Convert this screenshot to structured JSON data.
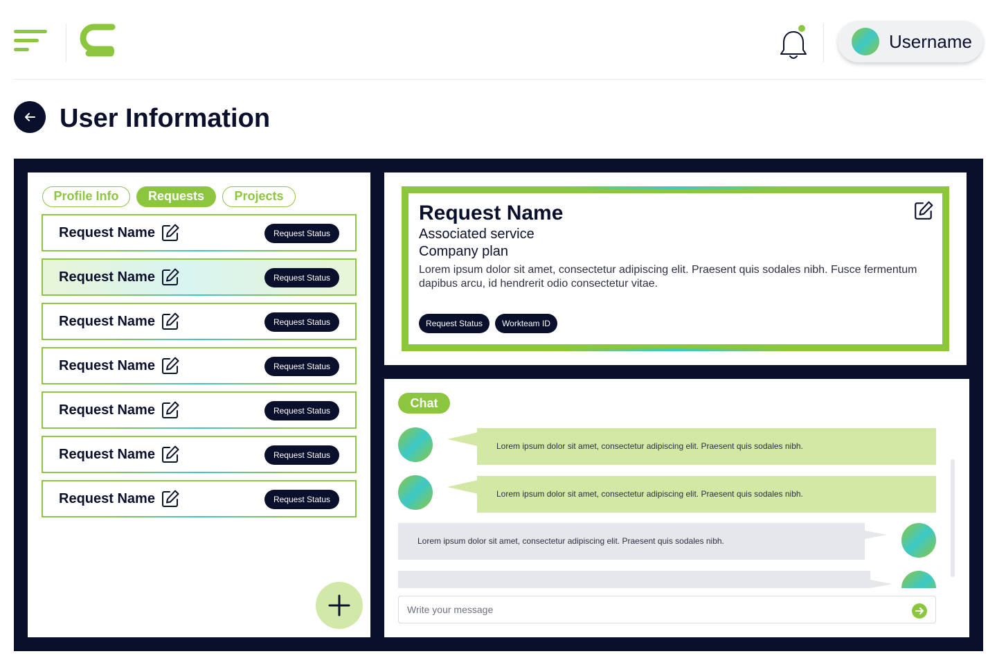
{
  "header": {
    "user_name": "Username",
    "notification_dot_color": "#8cc63f"
  },
  "page": {
    "title": "User Information"
  },
  "tabs": [
    {
      "label": "Profile Info",
      "active": false
    },
    {
      "label": "Requests",
      "active": true
    },
    {
      "label": "Projects",
      "active": false
    }
  ],
  "requests": [
    {
      "name": "Request Name",
      "status": "Request Status",
      "selected": false
    },
    {
      "name": "Request Name",
      "status": "Request Status",
      "selected": true
    },
    {
      "name": "Request Name",
      "status": "Request Status",
      "selected": false
    },
    {
      "name": "Request Name",
      "status": "Request Status",
      "selected": false
    },
    {
      "name": "Request Name",
      "status": "Request Status",
      "selected": false
    },
    {
      "name": "Request Name",
      "status": "Request Status",
      "selected": false
    },
    {
      "name": "Request Name",
      "status": "Request Status",
      "selected": false
    }
  ],
  "detail": {
    "title": "Request Name",
    "service": "Associated service",
    "plan": "Company plan",
    "description": "Lorem ipsum dolor sit amet, consectetur adipiscing elit. Praesent quis sodales nibh. Fusce fermentum dapibus arcu, id hendrerit odio consectetur vitae.",
    "badges": [
      "Request Status",
      "Workteam ID"
    ]
  },
  "chat": {
    "label": "Chat",
    "messages": [
      {
        "direction": "in",
        "text": "Lorem ipsum dolor sit amet, consectetur adipiscing elit. Praesent quis sodales nibh."
      },
      {
        "direction": "in",
        "text": "Lorem ipsum dolor sit amet, consectetur adipiscing elit. Praesent quis sodales nibh."
      },
      {
        "direction": "out",
        "text": "Lorem ipsum dolor sit amet, consectetur adipiscing elit. Praesent quis sodales nibh."
      },
      {
        "direction": "out",
        "text": ""
      }
    ],
    "input_placeholder": "Write your message"
  },
  "colors": {
    "accent": "#8cc63f",
    "accent_secondary": "#3cc8c8",
    "dark": "#0a0f2c",
    "incoming_bubble": "#d4e8a6",
    "outgoing_bubble": "#e6e7ea"
  },
  "icons": {
    "menu": "hamburger-menu-icon",
    "logo": "brand-logo-icon",
    "notification": "bell-icon",
    "back": "arrow-left-icon",
    "edit": "edit-icon",
    "add": "plus-icon",
    "send": "arrow-right-icon"
  }
}
